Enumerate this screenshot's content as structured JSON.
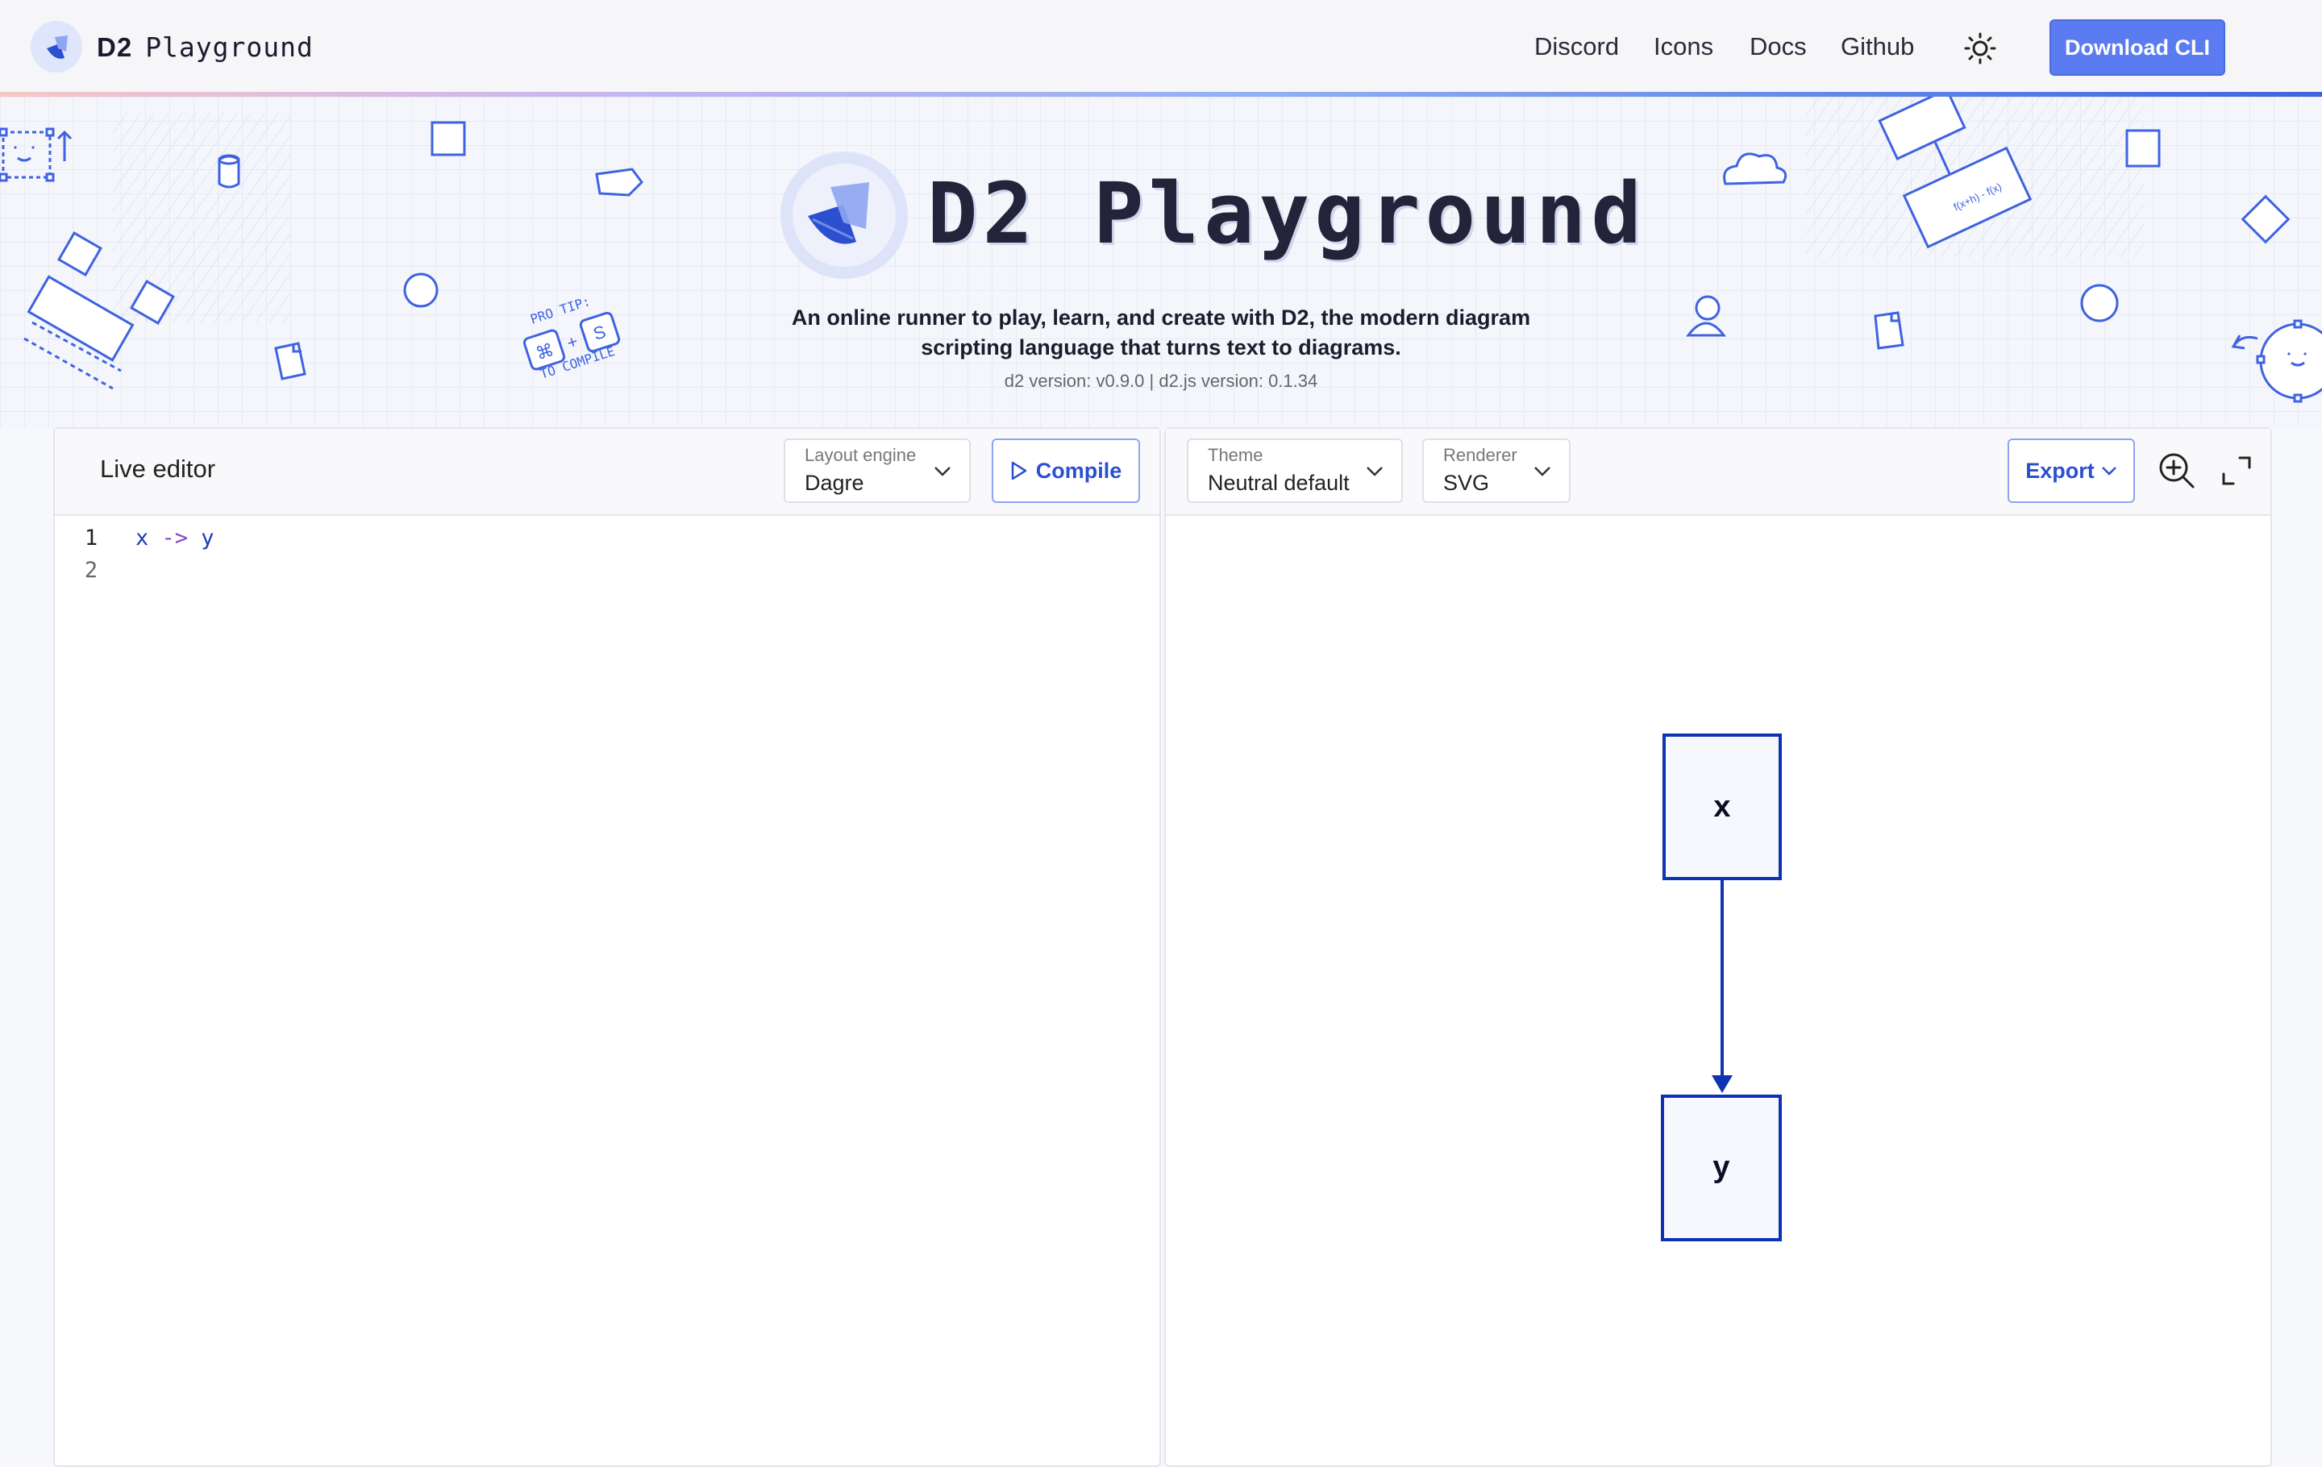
{
  "nav": {
    "brand_bold": "D2",
    "brand_text": "Playground",
    "links": [
      "Discord",
      "Icons",
      "Docs",
      "Github"
    ],
    "download_label": "Download CLI"
  },
  "hero": {
    "title": "D2 Playground",
    "subtitle_line1": "An online runner to play, learn, and create with D2, the modern diagram",
    "subtitle_line2": "scripting language that turns text to diagrams.",
    "version": "d2 version: v0.9.0 | d2.js version: 0.1.34",
    "pro_tip_line1": "PRO TIP:",
    "pro_tip_keys": [
      "⌘",
      "+",
      "S"
    ],
    "pro_tip_line2": "TO COMPILE"
  },
  "editor_panel": {
    "title": "Live editor",
    "layout_engine": {
      "label": "Layout engine",
      "value": "Dagre"
    },
    "compile_label": "Compile",
    "lines": [
      {
        "number": "1",
        "tokens": [
          "x",
          " -> ",
          "y"
        ]
      },
      {
        "number": "2",
        "tokens": []
      }
    ]
  },
  "preview_panel": {
    "theme": {
      "label": "Theme",
      "value": "Neutral default"
    },
    "renderer": {
      "label": "Renderer",
      "value": "SVG"
    },
    "export_label": "Export"
  },
  "diagram": {
    "nodes": [
      "x",
      "y"
    ],
    "edge": {
      "from": "x",
      "to": "y"
    },
    "colors": {
      "stroke": "#0d32b2",
      "fill": "#f7f8fe",
      "accent": "#5b7cf0"
    }
  }
}
